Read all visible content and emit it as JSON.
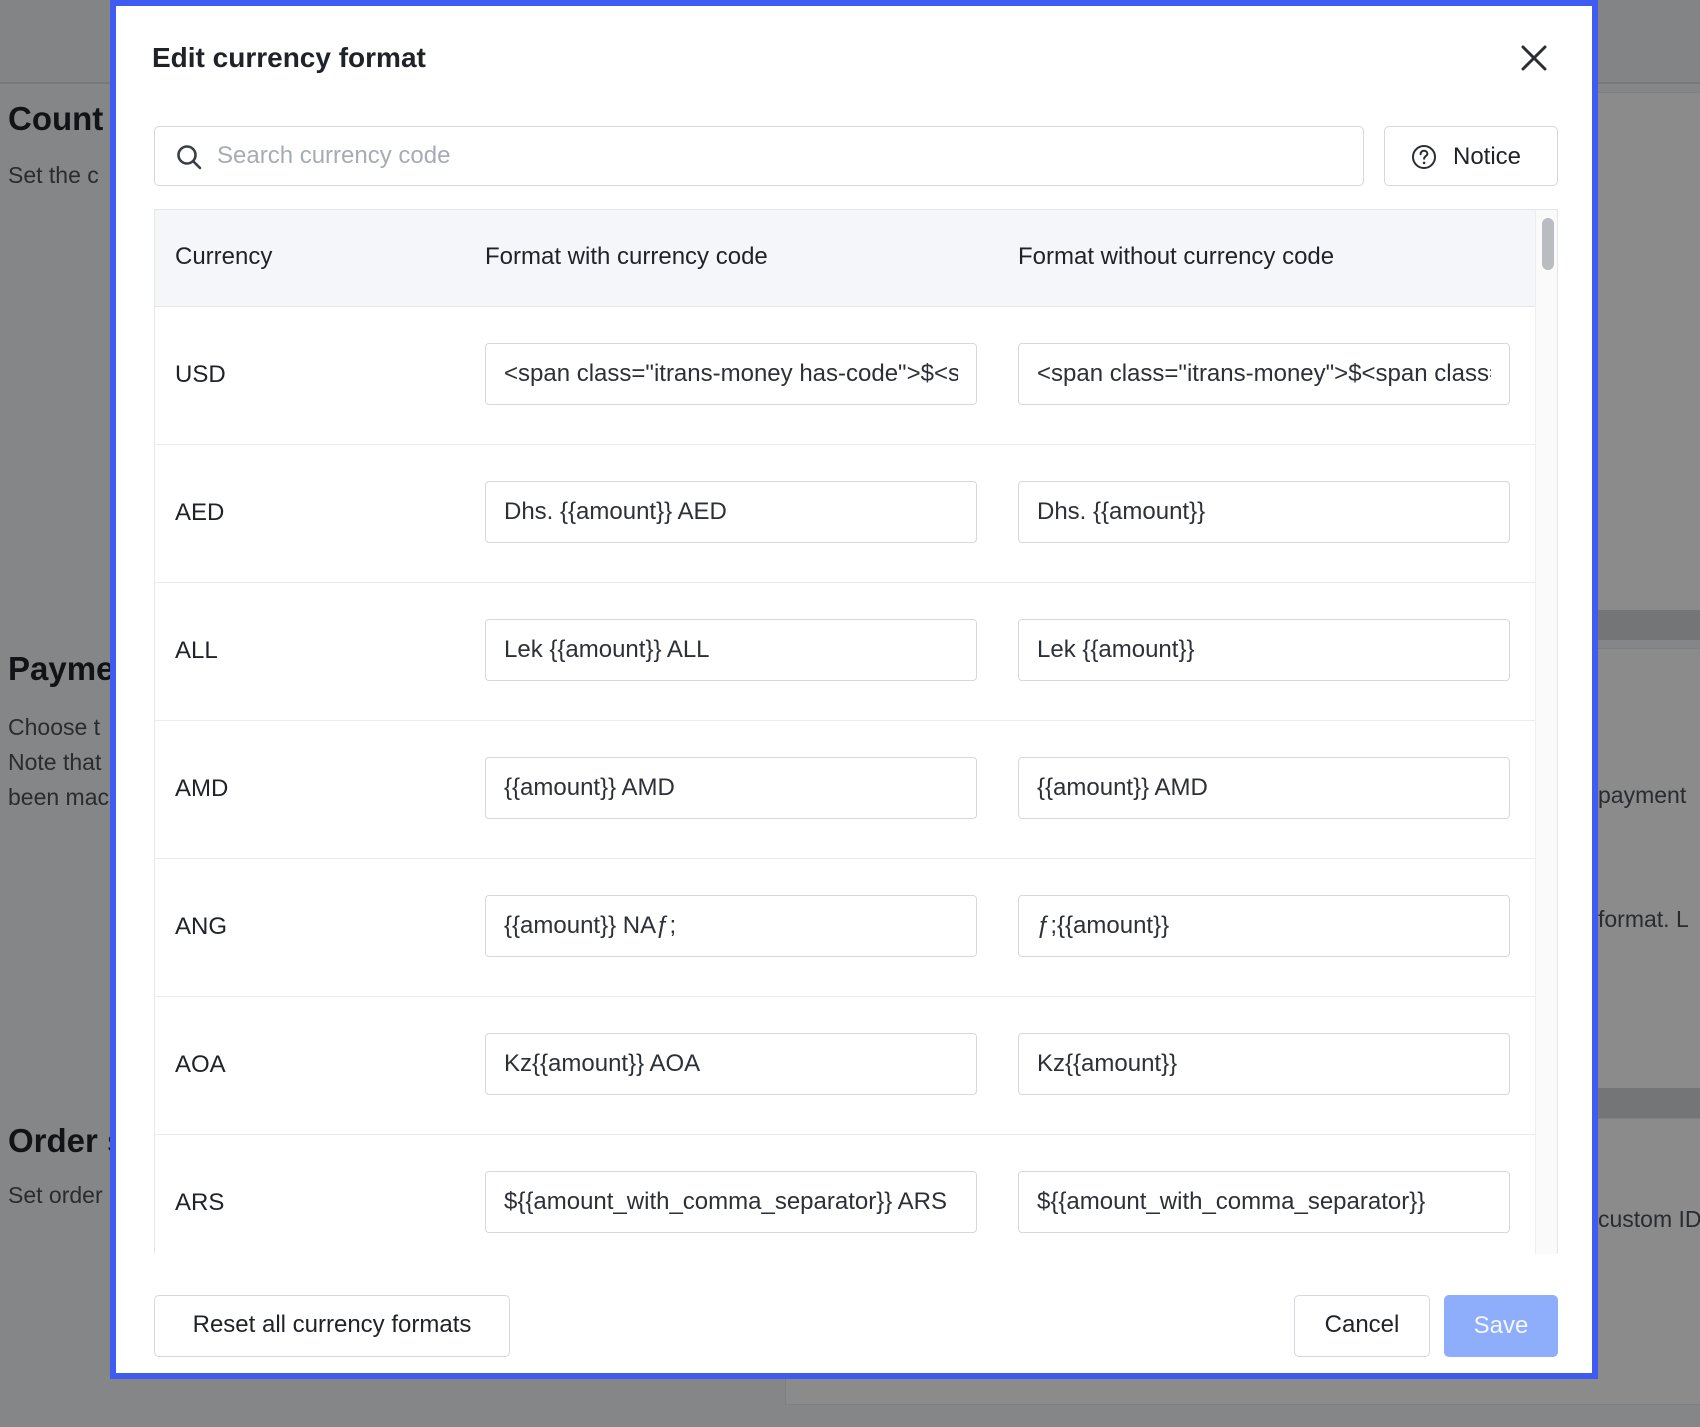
{
  "background": {
    "sections": [
      {
        "title": "Count",
        "lines": [
          "Set the c"
        ]
      },
      {
        "title": "Payme",
        "lines": [
          "Choose t",
          "Note that",
          "been mac"
        ]
      },
      {
        "title": "Order s",
        "lines": [
          "Set order"
        ]
      }
    ],
    "right_snippets": [
      "payment",
      "format. L",
      "custom ID"
    ]
  },
  "modal": {
    "title": "Edit currency format",
    "search": {
      "placeholder": "Search currency code",
      "value": ""
    },
    "notice_label": "Notice",
    "columns": [
      "Currency",
      "Format with currency code",
      "Format without currency code"
    ],
    "rows": [
      {
        "currency": "USD",
        "with_code": "<span class=\"itrans-money has-code\">$<span class=\"itrans-money-amount\">{{amount}}</span> USD</span>",
        "without_code": "<span class=\"itrans-money\">$<span class=\"itrans-money-amount\">{{amount}}</span></span>"
      },
      {
        "currency": "AED",
        "with_code": "Dhs. {{amount}} AED",
        "without_code": "Dhs. {{amount}}"
      },
      {
        "currency": "ALL",
        "with_code": "Lek {{amount}} ALL",
        "without_code": "Lek {{amount}}"
      },
      {
        "currency": "AMD",
        "with_code": "{{amount}} AMD",
        "without_code": "{{amount}} AMD"
      },
      {
        "currency": "ANG",
        "with_code": "{{amount}} NAƒ;",
        "without_code": "ƒ;{{amount}}"
      },
      {
        "currency": "AOA",
        "with_code": "Kz{{amount}} AOA",
        "without_code": "Kz{{amount}}"
      },
      {
        "currency": "ARS",
        "with_code": "${{amount_with_comma_separator}} ARS",
        "without_code": "${{amount_with_comma_separator}}"
      }
    ],
    "reset_label": "Reset all currency formats",
    "cancel_label": "Cancel",
    "save_label": "Save",
    "colors": {
      "border_accent": "#3e5bf2",
      "save_bg": "#8eaefc"
    }
  }
}
